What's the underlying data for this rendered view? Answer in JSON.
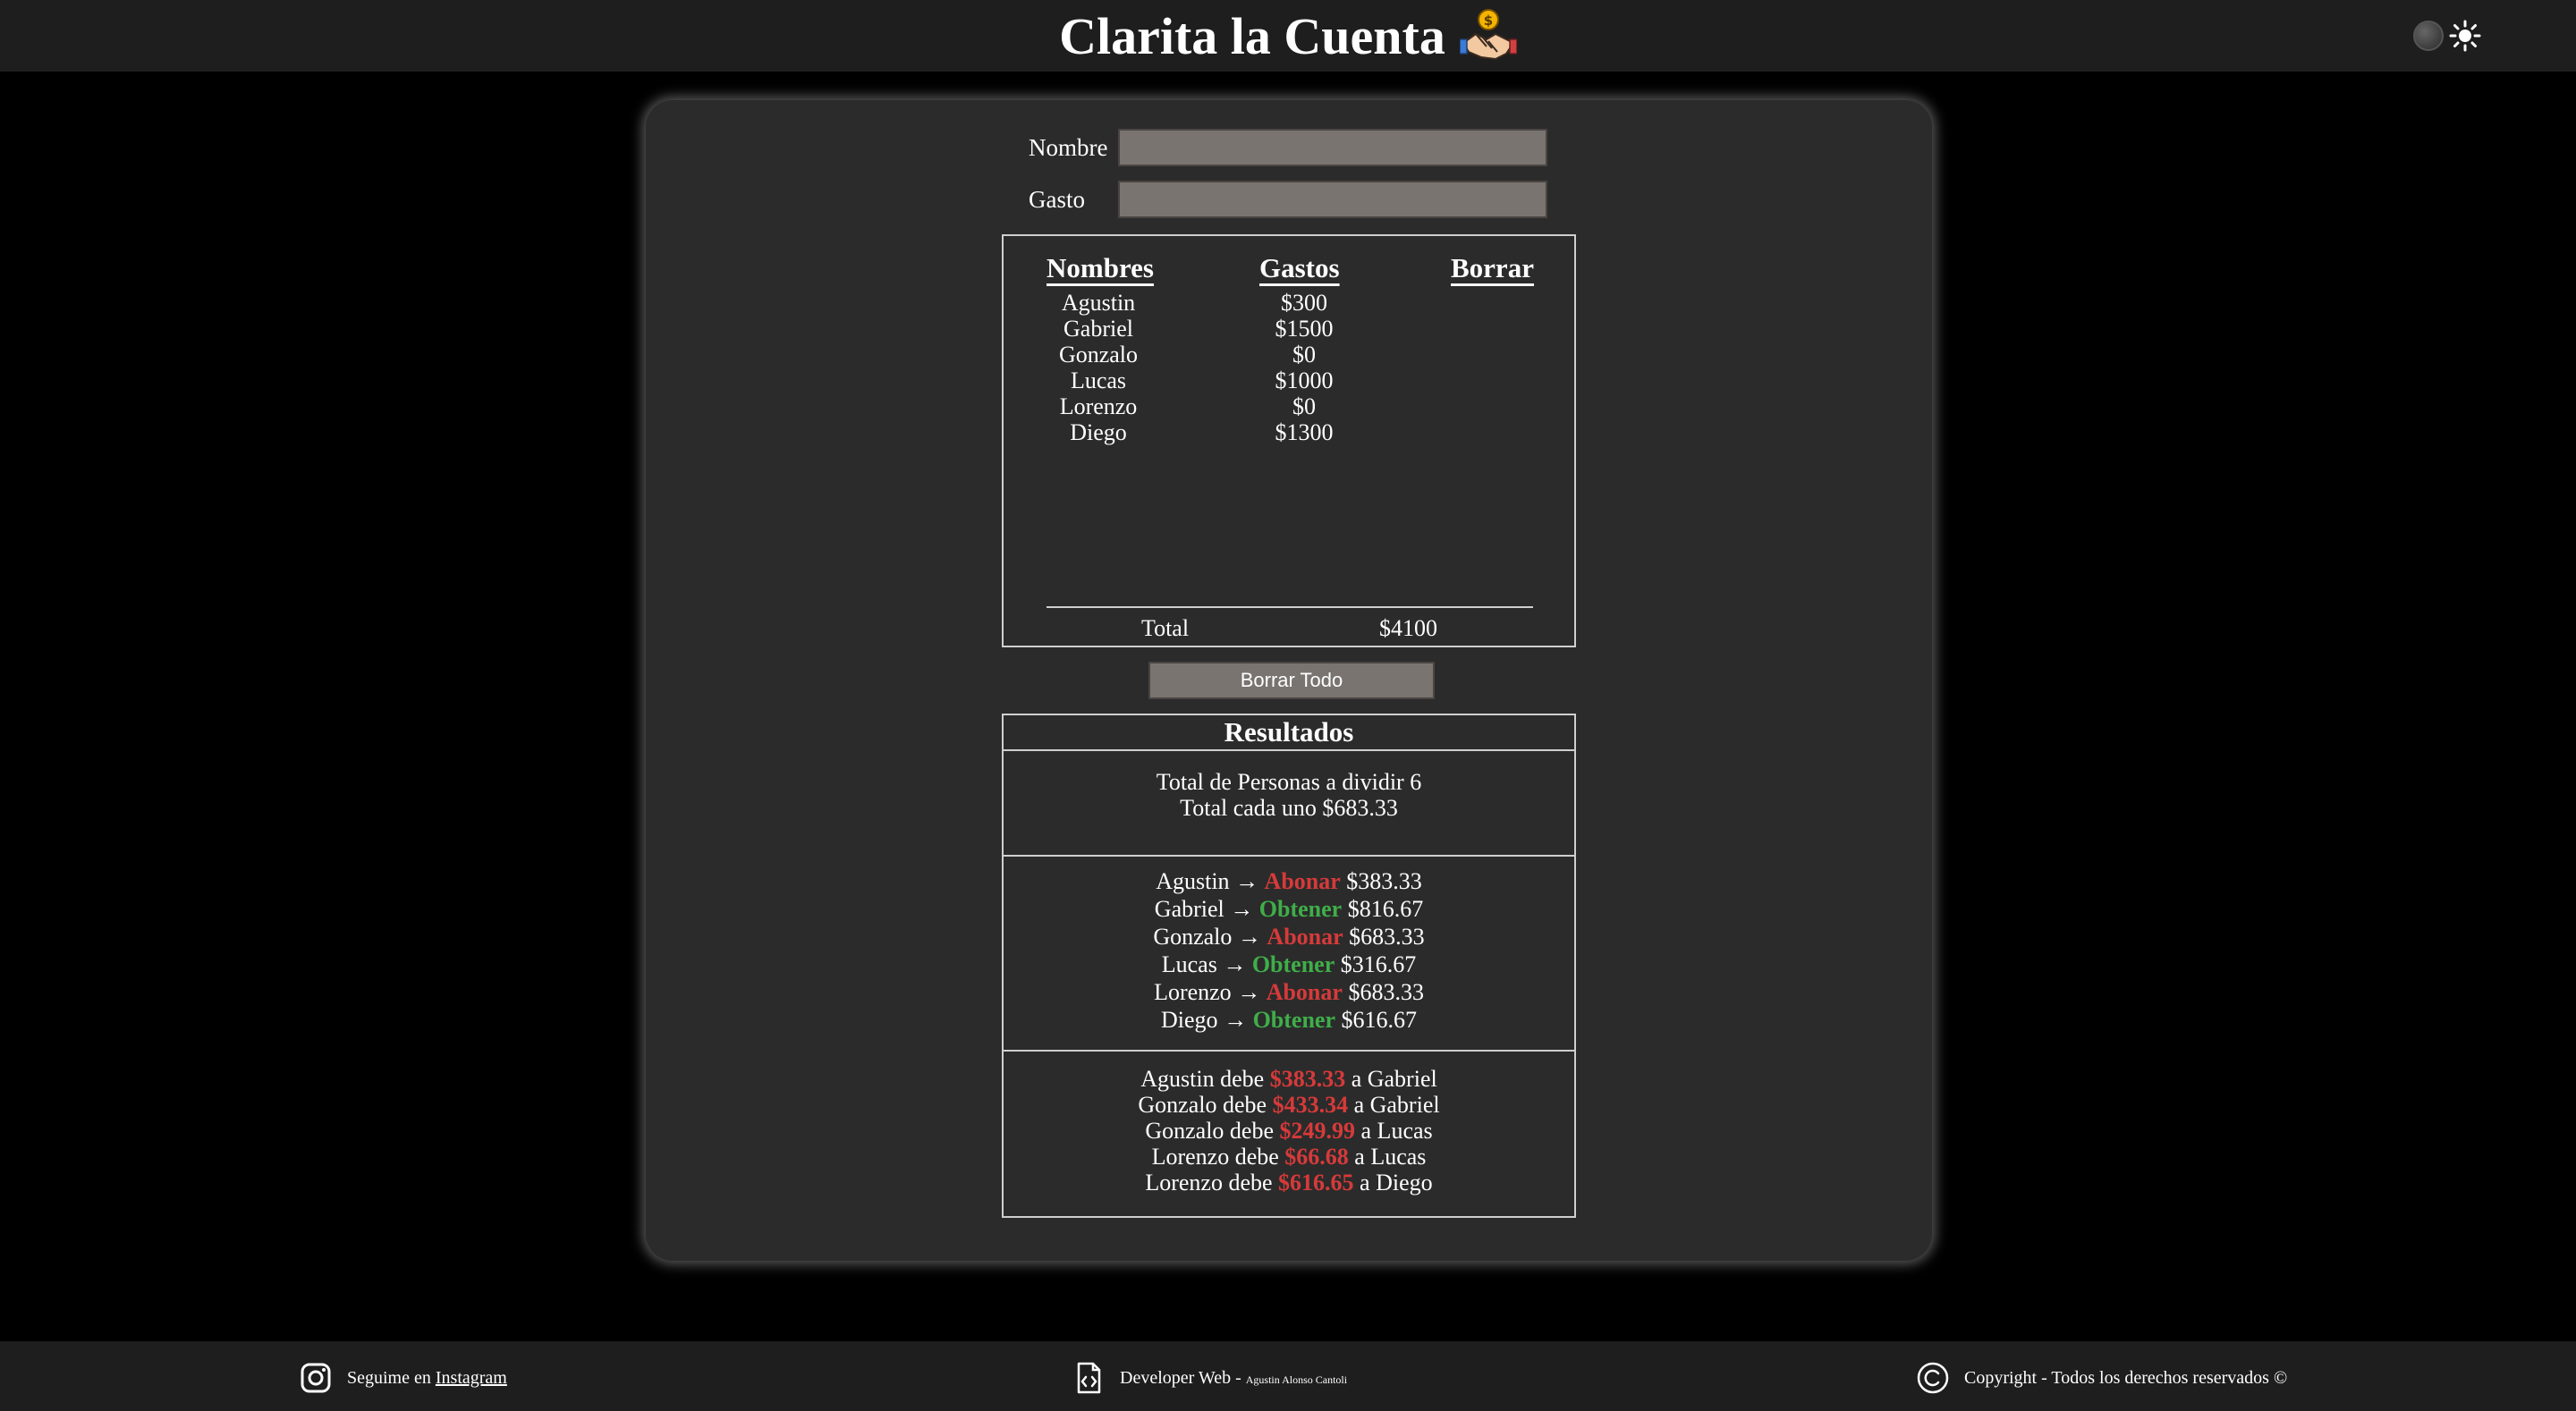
{
  "header": {
    "title": "Clarita la Cuenta",
    "logo_icon": "handshake-coin-icon",
    "theme_toggle_icon": "sun-icon"
  },
  "form": {
    "name_label": "Nombre",
    "name_value": "",
    "expense_label": "Gasto",
    "expense_value": ""
  },
  "expenses": {
    "headers": [
      "Nombres",
      "Gastos",
      "Borrar"
    ],
    "rows": [
      {
        "name": "Agustin",
        "amount": "$300"
      },
      {
        "name": "Gabriel",
        "amount": "$1500"
      },
      {
        "name": "Gonzalo",
        "amount": "$0"
      },
      {
        "name": "Lucas",
        "amount": "$1000"
      },
      {
        "name": "Lorenzo",
        "amount": "$0"
      },
      {
        "name": "Diego",
        "amount": "$1300"
      }
    ],
    "total_label": "Total",
    "total_value": "$4100"
  },
  "clear_button": "Borrar Todo",
  "results": {
    "title": "Resultados",
    "people_line": "Total de Personas a dividir 6",
    "each_line": "Total cada uno $683.33",
    "balances": [
      {
        "name": "Agustin",
        "arrow": " → ",
        "action": "Abonar",
        "kind": "red",
        "amount": " $383.33"
      },
      {
        "name": "Gabriel",
        "arrow": " → ",
        "action": "Obtener",
        "kind": "green",
        "amount": " $816.67"
      },
      {
        "name": "Gonzalo",
        "arrow": " → ",
        "action": "Abonar",
        "kind": "red",
        "amount": " $683.33"
      },
      {
        "name": "Lucas",
        "arrow": " → ",
        "action": "Obtener",
        "kind": "green",
        "amount": " $316.67"
      },
      {
        "name": "Lorenzo",
        "arrow": " → ",
        "action": "Abonar",
        "kind": "red",
        "amount": " $683.33"
      },
      {
        "name": "Diego",
        "arrow": " → ",
        "action": "Obtener",
        "kind": "green",
        "amount": " $616.67"
      }
    ],
    "debts": [
      {
        "from": "Agustin debe ",
        "amount": "$383.33",
        "to": " a Gabriel"
      },
      {
        "from": "Gonzalo debe ",
        "amount": "$433.34",
        "to": " a Gabriel"
      },
      {
        "from": "Gonzalo debe ",
        "amount": "$249.99",
        "to": " a Lucas"
      },
      {
        "from": "Lorenzo debe ",
        "amount": "$66.68",
        "to": " a Lucas"
      },
      {
        "from": "Lorenzo debe ",
        "amount": "$616.65",
        "to": " a Diego"
      }
    ]
  },
  "footer": {
    "instagram_text": "Seguime en ",
    "instagram_link": "Instagram",
    "dev_text": "Developer Web - ",
    "dev_name": "Agustin Alonso Cantoli",
    "copyright_text": "Copyright - Todos los derechos reservados ©"
  },
  "colors": {
    "abonar": "#d63a3a",
    "obtener": "#3fae49",
    "debt_amount": "#d63a3a"
  }
}
